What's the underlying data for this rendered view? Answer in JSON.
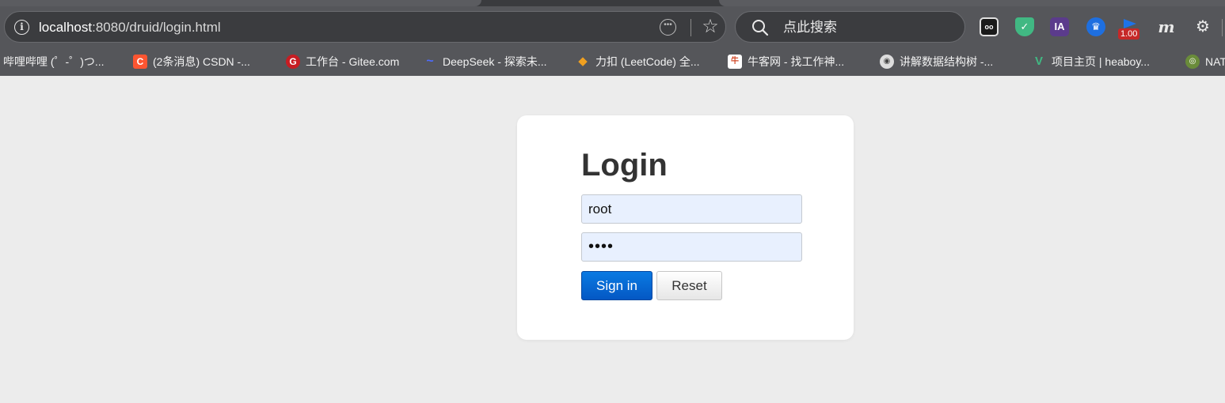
{
  "browser": {
    "url_host": "localhost",
    "url_port_path": ":8080/druid/login.html",
    "search_placeholder": "点此搜索",
    "extensions": {
      "ext_3_label": "IA",
      "ext_5_badge": "1.00",
      "ext_6_label": "m"
    },
    "bookmarks": [
      {
        "label": "哔哩哔哩 (゜-゜)つ..."
      },
      {
        "label": "(2条消息) CSDN -...",
        "icon": "C"
      },
      {
        "label": "工作台 - Gitee.com",
        "icon": "G"
      },
      {
        "label": "DeepSeek - 探索未...",
        "icon": "~"
      },
      {
        "label": "力扣 (LeetCode) 全...",
        "icon": "◆"
      },
      {
        "label": "牛客网 - 找工作神...",
        "icon": "牛"
      },
      {
        "label": "讲解数据结构树 -...",
        "icon": "◉"
      },
      {
        "label": "项目主页 | heaboy...",
        "icon": "V"
      },
      {
        "label": "NAT",
        "icon": "◎"
      }
    ]
  },
  "login": {
    "title": "Login",
    "username_value": "root",
    "password_masked": "••••",
    "signin_label": "Sign in",
    "reset_label": "Reset"
  }
}
